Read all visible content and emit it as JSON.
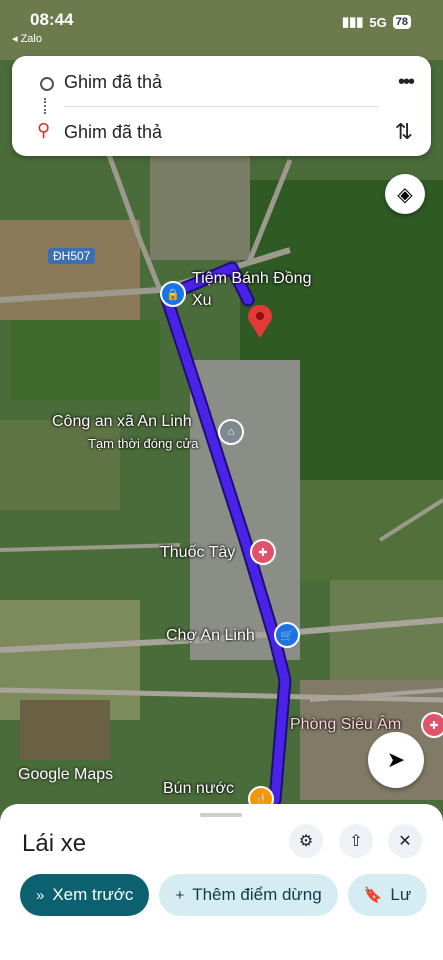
{
  "status_bar": {
    "time": "08:44",
    "back_app": "◂ Zalo",
    "network": "5G",
    "battery": "78"
  },
  "search": {
    "origin": "Ghim đã thả",
    "destination": "Ghim đã thả",
    "more_icon": "more-horiz-icon",
    "swap_icon": "swap-vert-icon"
  },
  "map": {
    "road_badge": "ĐH507",
    "places": [
      {
        "name": "Tiệm Bánh Đồng",
        "name2": "Xu"
      },
      {
        "name": "Công an xã An Linh",
        "sub": "Tạm thời đóng cửa"
      },
      {
        "name": "Thuốc Tây"
      },
      {
        "name": "Chợ An Linh"
      },
      {
        "name": "Phòng Siêu Âm"
      },
      {
        "name": "Bún nước"
      }
    ],
    "watermark": "Google Maps",
    "route_color": "#4a22e8"
  },
  "sheet": {
    "title": "Lái xe",
    "chips": [
      {
        "label": "Xem trước",
        "icon": "»"
      },
      {
        "label": "Thêm điểm dừng",
        "icon": "+"
      },
      {
        "label": "Lư",
        "icon": "🔖"
      }
    ]
  }
}
